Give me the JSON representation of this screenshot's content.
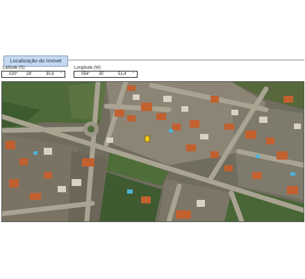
{
  "section": {
    "title": "Localização do Imóvel"
  },
  "latitude": {
    "label": "Latitude (S):",
    "deg": "020°",
    "min": "28'",
    "sec": "30,9",
    "sec_mark": "\""
  },
  "longitude": {
    "label": "Longitude (W):",
    "deg": "054°",
    "min": "35'",
    "sec": "51,4",
    "sec_mark": "\""
  },
  "map": {
    "marker_color": "#ffd21a"
  }
}
